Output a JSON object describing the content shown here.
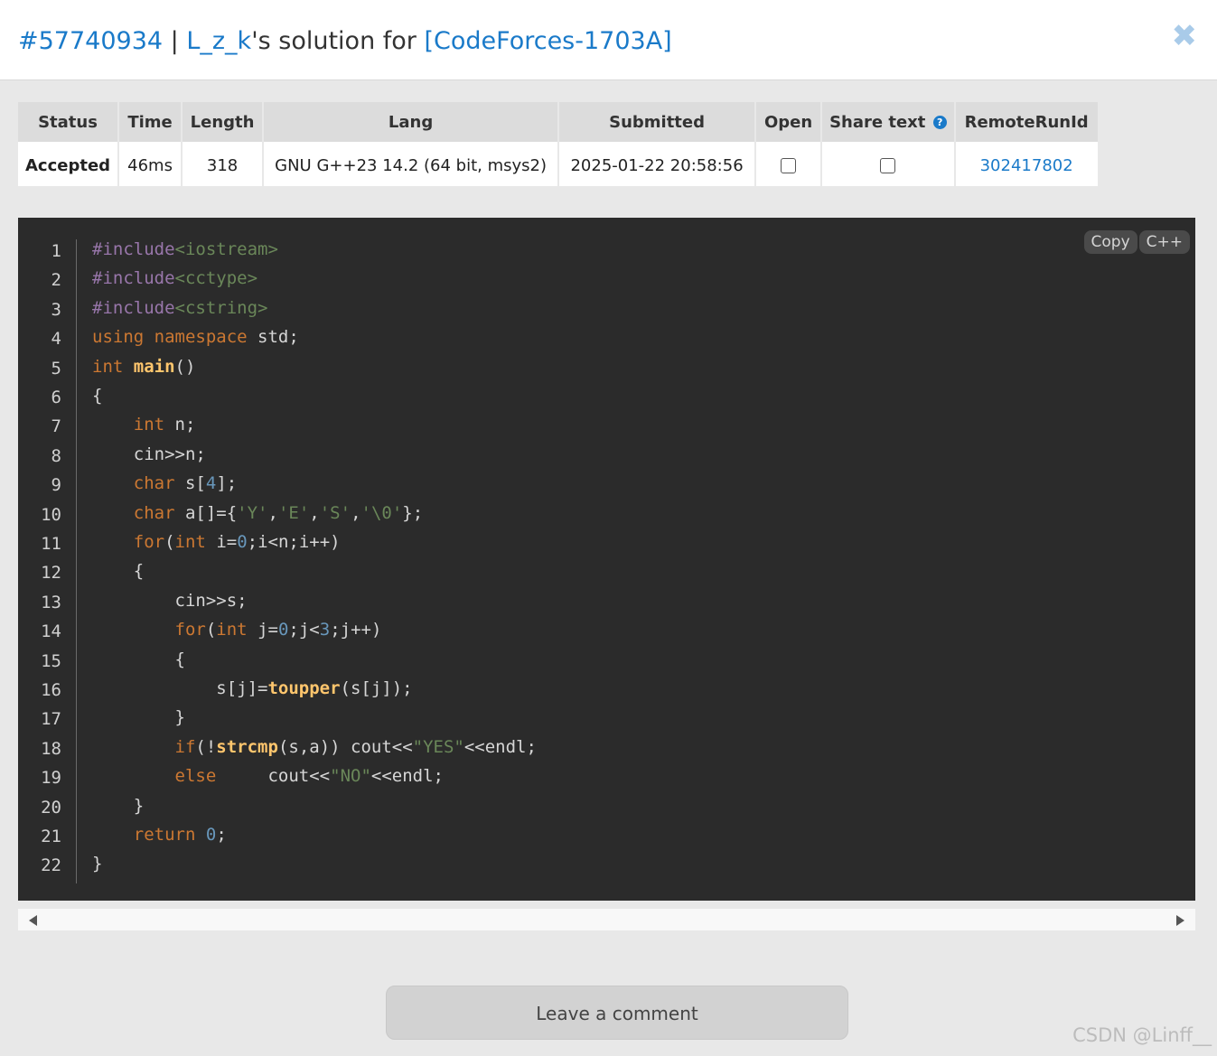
{
  "header": {
    "run_id": "#57740934",
    "separator": " | ",
    "user": "L_z_k",
    "middle_text": "'s solution for ",
    "problem": "[CodeForces-1703A]",
    "close_icon": "close-icon"
  },
  "table": {
    "headers": [
      "Status",
      "Time",
      "Length",
      "Lang",
      "Submitted",
      "Open",
      "Share text",
      "RemoteRunId"
    ],
    "row": {
      "status": "Accepted",
      "time": "46ms",
      "length": "318",
      "lang": "GNU G++23 14.2 (64 bit, msys2)",
      "submitted": "2025-01-22 20:58:56",
      "open_checked": false,
      "share_checked": false,
      "remote_run_id": "302417802"
    },
    "help_icon": "?"
  },
  "code": {
    "copy_label": "Copy",
    "lang_label": "C++",
    "line_numbers": [
      "1",
      "2",
      "3",
      "4",
      "5",
      "6",
      "7",
      "8",
      "9",
      "10",
      "11",
      "12",
      "13",
      "14",
      "15",
      "16",
      "17",
      "18",
      "19",
      "20",
      "21",
      "22"
    ],
    "lines": [
      "#include<iostream>",
      "#include<cctype>",
      "#include<cstring>",
      "using namespace std;",
      "int main()",
      "{",
      "    int n;",
      "    cin>>n;",
      "    char s[4];",
      "    char a[]={'Y','E','S','\\0'};",
      "    for(int i=0;i<n;i++)",
      "    {",
      "        cin>>s;",
      "        for(int j=0;j<3;j++)",
      "        {",
      "            s[j]=toupper(s[j]);",
      "        }",
      "        if(!strcmp(s,a)) cout<<\"YES\"<<endl;",
      "        else     cout<<\"NO\"<<endl;",
      "    }",
      "    return 0;",
      "}"
    ]
  },
  "comment_button": "Leave a comment",
  "watermark": "CSDN @Linff__",
  "colors": {
    "link": "#1a7ac9",
    "accepted": "#48b83f",
    "code_bg": "#2b2b2b"
  }
}
